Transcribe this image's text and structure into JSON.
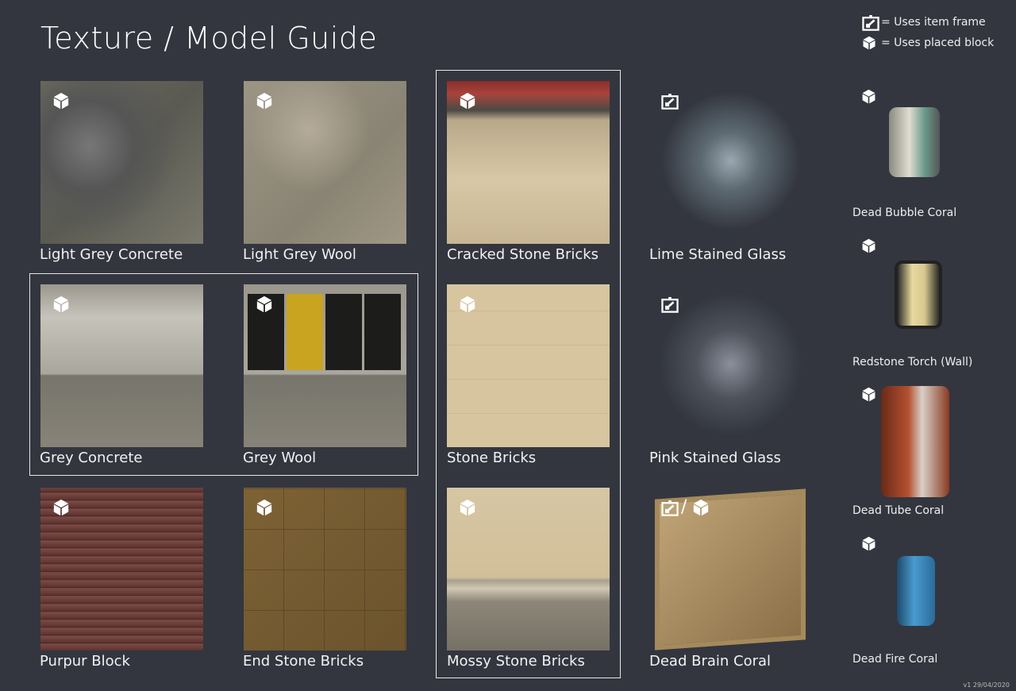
{
  "title": "Texture / Model Guide",
  "legend": {
    "item_frame": "= Uses item frame",
    "placed_block": "= Uses placed block"
  },
  "tiles": {
    "light_grey_concrete": "Light Grey Concrete",
    "light_grey_wool": "Light Grey Wool",
    "cracked_stone_bricks": "Cracked Stone Bricks",
    "grey_concrete": "Grey Concrete",
    "grey_wool": "Grey Wool",
    "stone_bricks": "Stone Bricks",
    "purpur_block": "Purpur Block",
    "end_stone_bricks": "End Stone Bricks",
    "mossy_stone_bricks": "Mossy Stone Bricks",
    "lime_stained_glass": "Lime Stained Glass",
    "pink_stained_glass": "Pink Stained Glass",
    "dead_brain_coral": "Dead Brain Coral"
  },
  "models": {
    "dead_bubble_coral": "Dead Bubble Coral",
    "redstone_torch_wall": "Redstone Torch (Wall)",
    "dead_tube_coral": "Dead Tube Coral",
    "dead_fire_coral": "Dead Fire Coral"
  },
  "slash": "/",
  "version": "v1  29/04/2020",
  "icons": {
    "frame": "item-frame-icon",
    "block": "placed-block-icon"
  }
}
